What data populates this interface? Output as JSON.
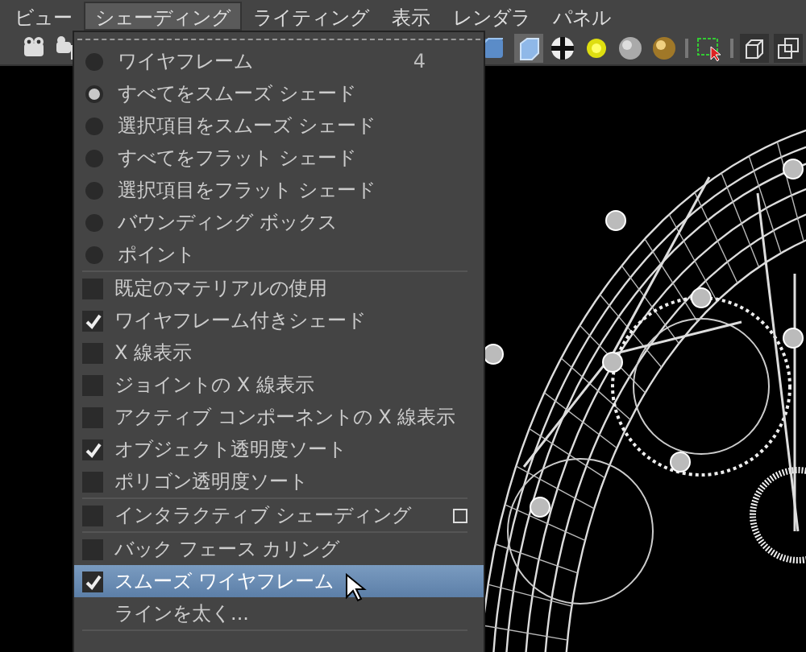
{
  "menubar": [
    {
      "label": "ビュー",
      "selected": false
    },
    {
      "label": "シェーディング",
      "selected": true
    },
    {
      "label": "ライティング",
      "selected": false
    },
    {
      "label": "表示",
      "selected": false
    },
    {
      "label": "レンダラ",
      "selected": false
    },
    {
      "label": "パネル",
      "selected": false
    }
  ],
  "menu": {
    "items": [
      {
        "kind": "radio",
        "label": "ワイヤフレーム",
        "selected": false,
        "shortcut": "4"
      },
      {
        "kind": "radio",
        "label": "すべてをスムーズ シェード",
        "selected": true
      },
      {
        "kind": "radio",
        "label": "選択項目をスムーズ シェード",
        "selected": false
      },
      {
        "kind": "radio",
        "label": "すべてをフラット シェード",
        "selected": false
      },
      {
        "kind": "radio",
        "label": "選択項目をフラット シェード",
        "selected": false
      },
      {
        "kind": "radio",
        "label": "バウンディング ボックス",
        "selected": false
      },
      {
        "kind": "radio",
        "label": "ポイント",
        "selected": false
      },
      {
        "kind": "separator"
      },
      {
        "kind": "check",
        "label": "既定のマテリアルの使用",
        "checked": false
      },
      {
        "kind": "check",
        "label": "ワイヤフレーム付きシェード",
        "checked": true
      },
      {
        "kind": "check",
        "label": "X 線表示",
        "checked": false
      },
      {
        "kind": "check",
        "label": "ジョイントの X 線表示",
        "checked": false
      },
      {
        "kind": "check",
        "label": "アクティブ コンポーネントの X 線表示",
        "checked": false
      },
      {
        "kind": "check",
        "label": "オブジェクト透明度ソート",
        "checked": true
      },
      {
        "kind": "check",
        "label": "ポリゴン透明度ソート",
        "checked": false
      },
      {
        "kind": "separator"
      },
      {
        "kind": "check",
        "label": "インタラクティブ シェーディング",
        "checked": false,
        "option_box": true
      },
      {
        "kind": "separator"
      },
      {
        "kind": "check",
        "label": "バック フェース カリング",
        "checked": false
      },
      {
        "kind": "check",
        "label": "スムーズ ワイヤフレーム",
        "checked": true,
        "highlighted": true
      },
      {
        "kind": "plain",
        "label": "ラインを太く..."
      },
      {
        "kind": "separator"
      }
    ]
  }
}
